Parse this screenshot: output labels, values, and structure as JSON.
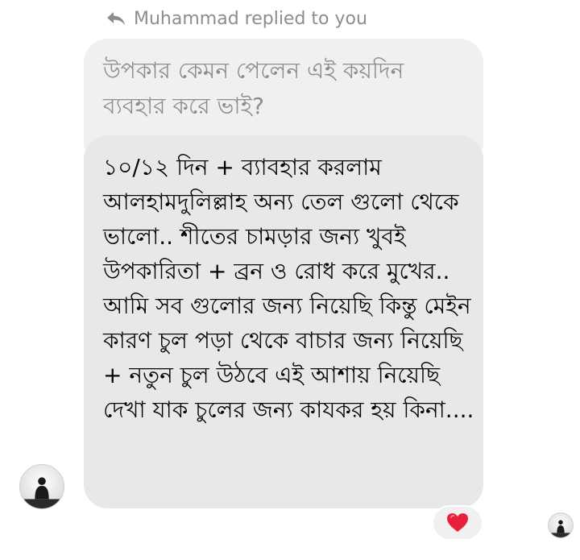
{
  "reply_header": {
    "icon": "reply-arrow-icon",
    "text": "Muhammad replied to you"
  },
  "quoted_message": {
    "text": "উপকার কেমন পেলেন এই কয়দিন ব্যবহার করে ভাই?"
  },
  "reply_message": {
    "text": "১০/১২ দিন + ব্যাবহার করলাম আলহামদুলিল্লাহ অন্য তেল গুলো থেকে ভালো.. শীতের চামড়ার জন্য খুবই উপকারিতা + ব্রন  ও রোধ করে মুখের..  আমি সব গুলোর জন্য নিয়েছি কিন্তু মেইন কারণ চুল পড়া থেকে বাচার জন্য নিয়েছি + নতুন চুল উঠবে এই আশায় নিয়েছি দেখা যাক চুলের জন্য কাযকর হয় কিনা...."
  },
  "reaction": {
    "icon": "red-heart-icon",
    "color": "#e8213b"
  },
  "colors": {
    "bubble_quoted": "#f0f0f0",
    "bubble_main": "#e8e8e8",
    "muted_text": "#8a8d91"
  }
}
